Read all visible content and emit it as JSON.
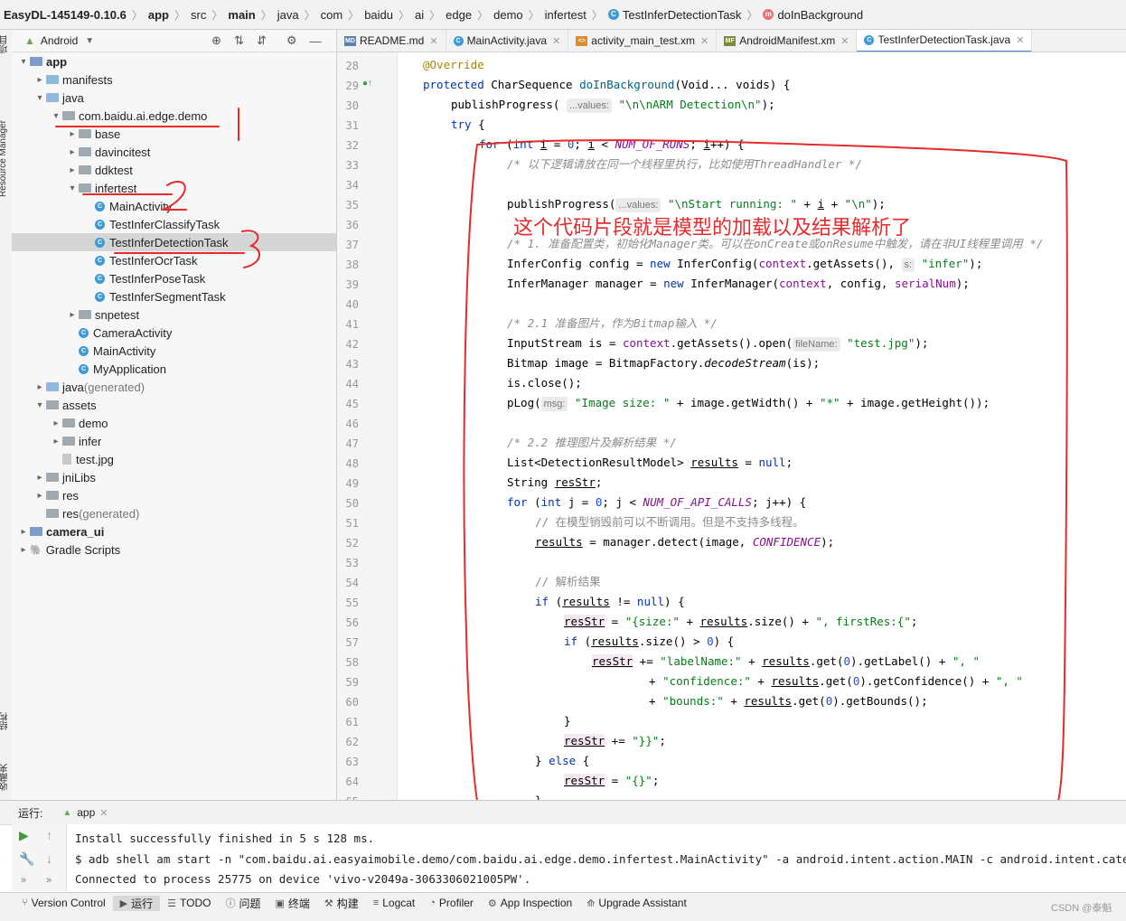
{
  "breadcrumb": [
    "EasyDL-145149-0.10.6",
    "app",
    "src",
    "main",
    "java",
    "com",
    "baidu",
    "ai",
    "edge",
    "demo",
    "infertest",
    "TestInferDetectionTask",
    "doInBackground"
  ],
  "left_strip": {
    "top_label": "项目",
    "resource_label": "Resource Manager",
    "structure_label": "结构",
    "favorites_label": "收藏夹",
    "build_label": "Build Variants"
  },
  "project_panel": {
    "view_selector": "Android",
    "tree": [
      {
        "label": "app",
        "indent": 0,
        "arrow": "▾",
        "icon": "module",
        "bold": true
      },
      {
        "label": "manifests",
        "indent": 1,
        "arrow": "▸",
        "icon": "folder"
      },
      {
        "label": "java",
        "indent": 1,
        "arrow": "▾",
        "icon": "folder"
      },
      {
        "label": "com.baidu.ai.edge.demo",
        "indent": 2,
        "arrow": "▾",
        "icon": "grey"
      },
      {
        "label": "base",
        "indent": 3,
        "arrow": "▸",
        "icon": "grey"
      },
      {
        "label": "davincitest",
        "indent": 3,
        "arrow": "▸",
        "icon": "grey"
      },
      {
        "label": "ddktest",
        "indent": 3,
        "arrow": "▸",
        "icon": "grey"
      },
      {
        "label": "infertest",
        "indent": 3,
        "arrow": "▾",
        "icon": "grey"
      },
      {
        "label": "MainActivity",
        "indent": 4,
        "arrow": "",
        "icon": "class"
      },
      {
        "label": "TestInferClassifyTask",
        "indent": 4,
        "arrow": "",
        "icon": "class"
      },
      {
        "label": "TestInferDetectionTask",
        "indent": 4,
        "arrow": "",
        "icon": "class",
        "selected": true
      },
      {
        "label": "TestInferOcrTask",
        "indent": 4,
        "arrow": "",
        "icon": "class"
      },
      {
        "label": "TestInferPoseTask",
        "indent": 4,
        "arrow": "",
        "icon": "class"
      },
      {
        "label": "TestInferSegmentTask",
        "indent": 4,
        "arrow": "",
        "icon": "class"
      },
      {
        "label": "snpetest",
        "indent": 3,
        "arrow": "▸",
        "icon": "grey"
      },
      {
        "label": "CameraActivity",
        "indent": 3,
        "arrow": "",
        "icon": "class"
      },
      {
        "label": "MainActivity",
        "indent": 3,
        "arrow": "",
        "icon": "class"
      },
      {
        "label": "MyApplication",
        "indent": 3,
        "arrow": "",
        "icon": "class"
      },
      {
        "label": "java",
        "suffix": " (generated)",
        "indent": 1,
        "arrow": "▸",
        "icon": "folder"
      },
      {
        "label": "assets",
        "indent": 1,
        "arrow": "▾",
        "icon": "grey"
      },
      {
        "label": "demo",
        "indent": 2,
        "arrow": "▸",
        "icon": "grey"
      },
      {
        "label": "infer",
        "indent": 2,
        "arrow": "▸",
        "icon": "grey"
      },
      {
        "label": "test.jpg",
        "indent": 2,
        "arrow": "",
        "icon": "image"
      },
      {
        "label": "jniLibs",
        "indent": 1,
        "arrow": "▸",
        "icon": "grey"
      },
      {
        "label": "res",
        "indent": 1,
        "arrow": "▸",
        "icon": "grey"
      },
      {
        "label": "res",
        "suffix": " (generated)",
        "indent": 1,
        "arrow": "",
        "icon": "grey"
      },
      {
        "label": "camera_ui",
        "indent": 0,
        "arrow": "▸",
        "icon": "module",
        "bold": true
      },
      {
        "label": "Gradle Scripts",
        "indent": 0,
        "arrow": "▸",
        "icon": "gradle"
      }
    ]
  },
  "editor_tabs": [
    {
      "label": "README.md",
      "icon": "md",
      "color": "#5a7fb0"
    },
    {
      "label": "MainActivity.java",
      "icon": "c",
      "color": "#3e9ad8"
    },
    {
      "label": "activity_main_test.xm",
      "icon": "xml",
      "color": "#e08a2c"
    },
    {
      "label": "AndroidManifest.xm",
      "icon": "mf",
      "color": "#7a8c3a"
    },
    {
      "label": "TestInferDetectionTask.java",
      "icon": "c",
      "color": "#3e9ad8",
      "active": true
    }
  ],
  "line_numbers": [
    "28",
    "29",
    "30",
    "31",
    "32",
    "33",
    "34",
    "35",
    "36",
    "37",
    "38",
    "39",
    "40",
    "41",
    "42",
    "43",
    "44",
    "45",
    "46",
    "47",
    "48",
    "49",
    "50",
    "51",
    "52",
    "53",
    "54",
    "55",
    "56",
    "57",
    "58",
    "59",
    "60",
    "61",
    "62",
    "63",
    "64",
    "65"
  ],
  "code": {
    "hint_values": "...values:",
    "hint_s": "s:",
    "hint_filename": "fileName:",
    "hint_msg": "msg:",
    "l28_override": "@Override",
    "l29_protected": "protected",
    "l29_type": " CharSequence ",
    "l29_fn": "doInBackground",
    "l29_rest": "(Void... voids) {",
    "l30_call": "publishProgress(",
    "l30_str": "\"\\n\\nARM Detection\\n\"",
    "l30_end": ");",
    "l31_try": "try",
    "l31_brace": " {",
    "l32_for": "for",
    "l32_a": " (",
    "l32_int": "int",
    "l32_i": "i",
    "l32_eq": " = ",
    "l32_zero": "0",
    "l32_semi": "; ",
    "l32_i2": "i",
    "l32_lt": " < ",
    "l32_const": "NUM_OF_RUNS",
    "l32_semi2": "; ",
    "l32_i3": "i",
    "l32_end": "++) {",
    "l33_comment": "/* 以下逻辑请放在同一个线程里执行，比如使用ThreadHandler */",
    "l35_call": "publishProgress(",
    "l35_str1": "\"\\nStart running: \"",
    "l35_plus": " + ",
    "l35_i": "i",
    "l35_plus2": " + ",
    "l35_str2": "\"\\n\"",
    "l35_end": ");",
    "l37_comment": "/* 1. 准备配置类，初始化Manager类。可以在onCreate或onResume中触发，请在非UI线程里调用 */",
    "l38_a": "InferConfig config = ",
    "l38_new": "new",
    "l38_b": " InferConfig(",
    "l38_ctx": "context",
    "l38_c": ".getAssets(), ",
    "l38_str": "\"infer\"",
    "l38_end": ");",
    "l39_a": "InferManager manager = ",
    "l39_new": "new",
    "l39_b": " InferManager(",
    "l39_ctx": "context",
    "l39_c": ", config, ",
    "l39_fld": "serialNum",
    "l39_end": ");",
    "l41_comment": "/* 2.1 准备图片，作为Bitmap输入 */",
    "l42_a": "InputStream is = ",
    "l42_ctx": "context",
    "l42_b": ".getAssets().open(",
    "l42_str": "\"test.jpg\"",
    "l42_end": ");",
    "l43_a": "Bitmap image = BitmapFactory.",
    "l43_fn": "decodeStream",
    "l43_end": "(is);",
    "l44": "is.close();",
    "l45_a": "pLog(",
    "l45_str1": "\"Image size: \"",
    "l45_b": " + image.getWidth() + ",
    "l45_str2": "\"*\"",
    "l45_c": " + image.getHeight());",
    "l47_comment": "/* 2.2 推理图片及解析结果 */",
    "l48_a": "List<DetectionResultModel> ",
    "l48_var": "results",
    "l48_b": " = ",
    "l48_null": "null",
    "l48_end": ";",
    "l49_a": "String ",
    "l49_var": "resStr",
    "l49_end": ";",
    "l50_for": "for",
    "l50_a": " (",
    "l50_int": "int",
    "l50_b": " j = ",
    "l50_zero": "0",
    "l50_c": "; j < ",
    "l50_const": "NUM_OF_API_CALLS",
    "l50_end": "; j++) {",
    "l51_comment": "// 在模型销毁前可以不断调用。但是不支持多线程。",
    "l52_var": "results",
    "l52_a": " = manager.detect(image, ",
    "l52_const": "CONFIDENCE",
    "l52_end": ");",
    "l54_comment": "// 解析结果",
    "l55_if": "if",
    "l55_a": " (",
    "l55_var": "results",
    "l55_b": " != ",
    "l55_null": "null",
    "l55_end": ") {",
    "l56_var": "resStr",
    "l56_a": " = ",
    "l56_str1": "\"{size:\"",
    "l56_b": " + ",
    "l56_var2": "results",
    "l56_c": ".size() + ",
    "l56_str2": "\", firstRes:{\"",
    "l56_end": ";",
    "l57_if": "if",
    "l57_a": " (",
    "l57_var": "results",
    "l57_b": ".size() > ",
    "l57_zero": "0",
    "l57_end": ") {",
    "l58_var": "resStr",
    "l58_a": " += ",
    "l58_str1": "\"labelName:\"",
    "l58_b": " + ",
    "l58_var2": "results",
    "l58_c": ".get(",
    "l58_zero": "0",
    "l58_d": ").getLabel() + ",
    "l58_str2": "\", \"",
    "l59_a": "+ ",
    "l59_str1": "\"confidence:\"",
    "l59_b": " + ",
    "l59_var": "results",
    "l59_c": ".get(",
    "l59_zero": "0",
    "l59_d": ").getConfidence() + ",
    "l59_str2": "\", \"",
    "l60_a": "+ ",
    "l60_str1": "\"bounds:\"",
    "l60_b": " + ",
    "l60_var": "results",
    "l60_c": ".get(",
    "l60_zero": "0",
    "l60_d": ").getBounds();",
    "l61": "}",
    "l62_var": "resStr",
    "l62_a": " += ",
    "l62_str": "\"}}\"",
    "l62_end": ";",
    "l63_a": "} ",
    "l63_else": "else",
    "l63_end": " {",
    "l64_var": "resStr",
    "l64_a": " = ",
    "l64_str": "\"{}\"",
    "l64_end": ";",
    "l65": "}"
  },
  "annotation_note": "这个代码片段就是模型的加载以及结果解析了",
  "run_panel": {
    "label": "运行:",
    "tab": "app",
    "lines": [
      "Install successfully finished in 5 s 128 ms.",
      "$ adb shell am start -n \"com.baidu.ai.easyaimobile.demo/com.baidu.ai.edge.demo.infertest.MainActivity\" -a android.intent.action.MAIN -c android.intent.category.LAUNCHER",
      "Connected to process 25775 on device 'vivo-v2049a-3063306021005PW'."
    ]
  },
  "bottom_tools": [
    {
      "label": "Version Control",
      "icon": "⑂"
    },
    {
      "label": "运行",
      "icon": "▶",
      "active": true
    },
    {
      "label": "TODO",
      "icon": "☰"
    },
    {
      "label": "问题",
      "icon": "ⓘ"
    },
    {
      "label": "终端",
      "icon": "▣"
    },
    {
      "label": "构建",
      "icon": "⚒"
    },
    {
      "label": "Logcat",
      "icon": "≡"
    },
    {
      "label": "Profiler",
      "icon": "◔"
    },
    {
      "label": "App Inspection",
      "icon": "⚙"
    },
    {
      "label": "Upgrade Assistant",
      "icon": "⟰"
    }
  ],
  "watermark": "CSDN @泰魁"
}
